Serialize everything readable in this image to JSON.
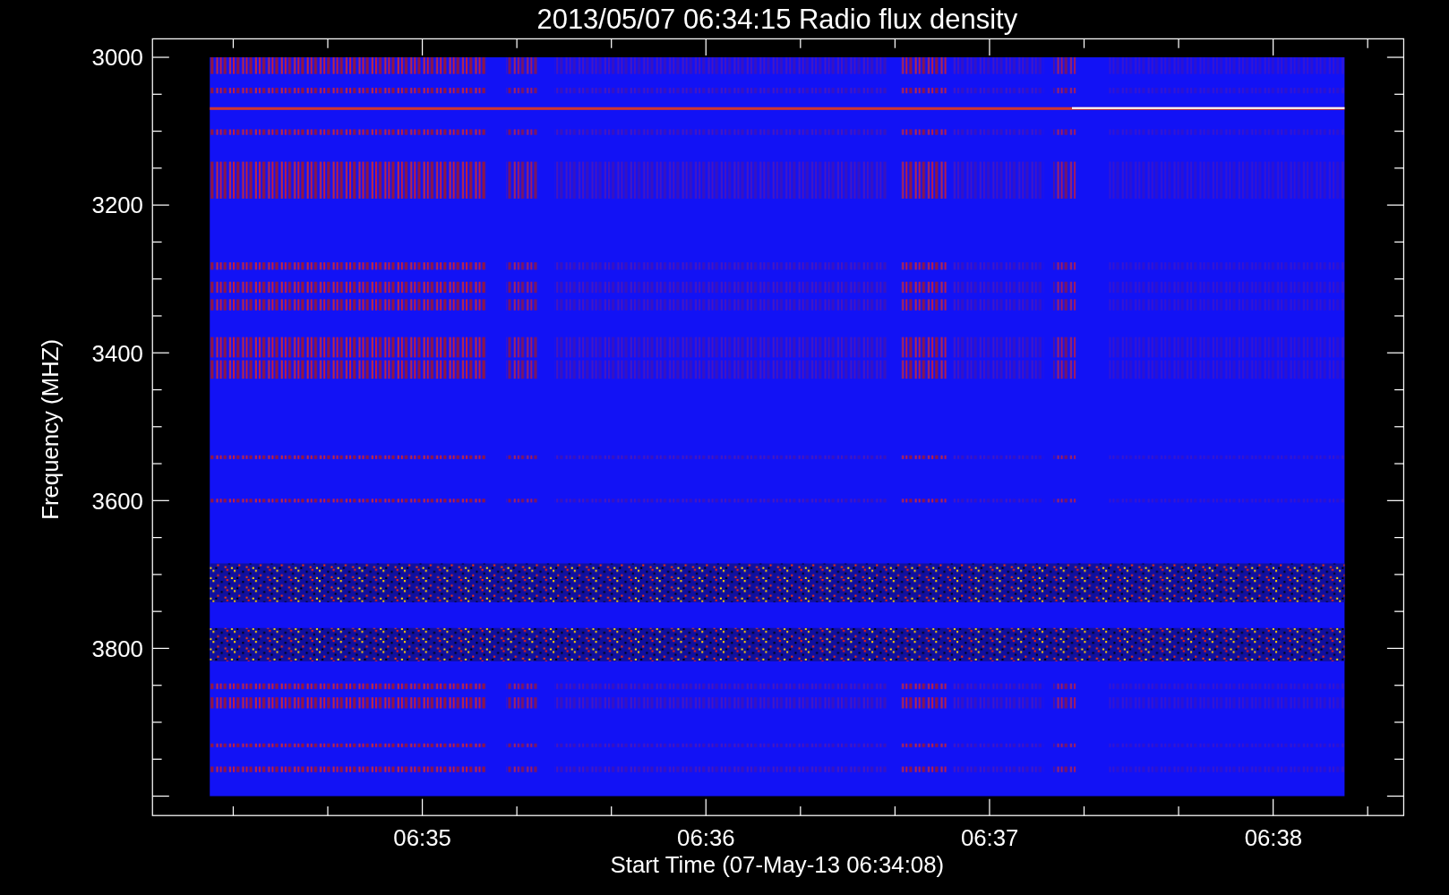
{
  "plot": {
    "title": "2013/05/07 06:34:15 Radio flux density",
    "y_axis": {
      "label": "Frequency (MHZ)",
      "ticks": [
        "3000",
        "3200",
        "3400",
        "3600",
        "3800"
      ]
    },
    "x_axis": {
      "label": "Start Time (07-May-13 06:34:08)",
      "ticks": [
        "06:35",
        "06:36",
        "06:37",
        "06:38"
      ]
    }
  }
}
